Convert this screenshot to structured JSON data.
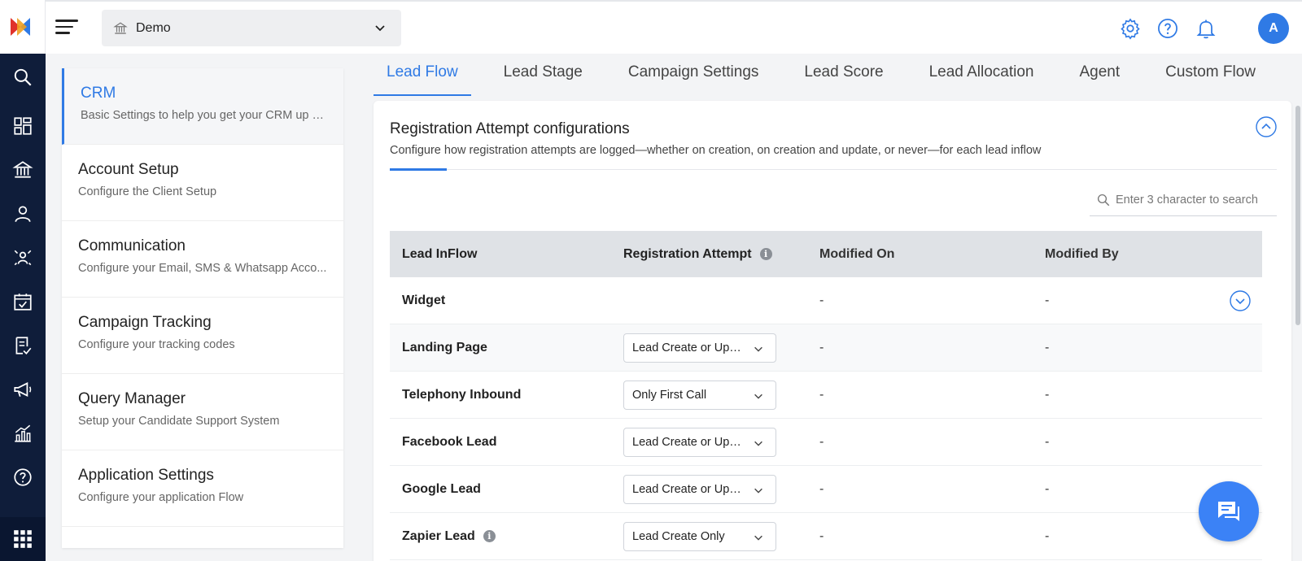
{
  "colors": {
    "accent": "#2f7ae5",
    "rail": "#0f1d3a"
  },
  "rail": {
    "icons": [
      "search-icon",
      "dashboard-icon",
      "institution-icon",
      "user-icon",
      "network-icon",
      "calendar-check-icon",
      "report-icon",
      "campaign-icon",
      "analytics-icon",
      "help-icon",
      "apps-grid-icon"
    ]
  },
  "header": {
    "institute": "Demo",
    "avatar_initial": "A",
    "icons": [
      "gear-icon",
      "help-circle-icon",
      "bell-icon"
    ]
  },
  "menu": {
    "items": [
      {
        "title": "CRM",
        "desc": "Basic Settings to help you get your CRM up a...",
        "active": true
      },
      {
        "title": "Account Setup",
        "desc": "Configure the Client Setup"
      },
      {
        "title": "Communication",
        "desc": "Configure your Email, SMS & Whatsapp Acco..."
      },
      {
        "title": "Campaign Tracking",
        "desc": "Configure your tracking codes"
      },
      {
        "title": "Query Manager",
        "desc": "Setup your Candidate Support System"
      },
      {
        "title": "Application Settings",
        "desc": "Configure your application Flow"
      }
    ]
  },
  "tabs": [
    "Lead Flow",
    "Lead Stage",
    "Campaign Settings",
    "Lead Score",
    "Lead Allocation",
    "Agent",
    "Custom Flow"
  ],
  "card": {
    "title": "Registration Attempt configurations",
    "desc": "Configure how registration attempts are logged—whether on creation, on creation and update, or never—for each lead inflow",
    "search_placeholder": "Enter 3 character to search"
  },
  "table": {
    "headers": [
      "Lead InFlow",
      "Registration Attempt",
      "Modified On",
      "Modified By"
    ],
    "rows": [
      {
        "inflow": "Widget",
        "attempt": "",
        "modified_on": "-",
        "modified_by": "-"
      },
      {
        "inflow": "Landing Page",
        "attempt": "Lead Create or Update",
        "modified_on": "-",
        "modified_by": "-"
      },
      {
        "inflow": "Telephony Inbound",
        "attempt": "Only First Call",
        "modified_on": "-",
        "modified_by": "-"
      },
      {
        "inflow": "Facebook Lead",
        "attempt": "Lead Create or Update",
        "modified_on": "-",
        "modified_by": "-"
      },
      {
        "inflow": "Google Lead",
        "attempt": "Lead Create or Update",
        "modified_on": "-",
        "modified_by": "-"
      },
      {
        "inflow": "Zapier Lead",
        "attempt": "Lead Create Only",
        "modified_on": "-",
        "modified_by": "-"
      }
    ]
  },
  "chat_icon": "chat-icon"
}
